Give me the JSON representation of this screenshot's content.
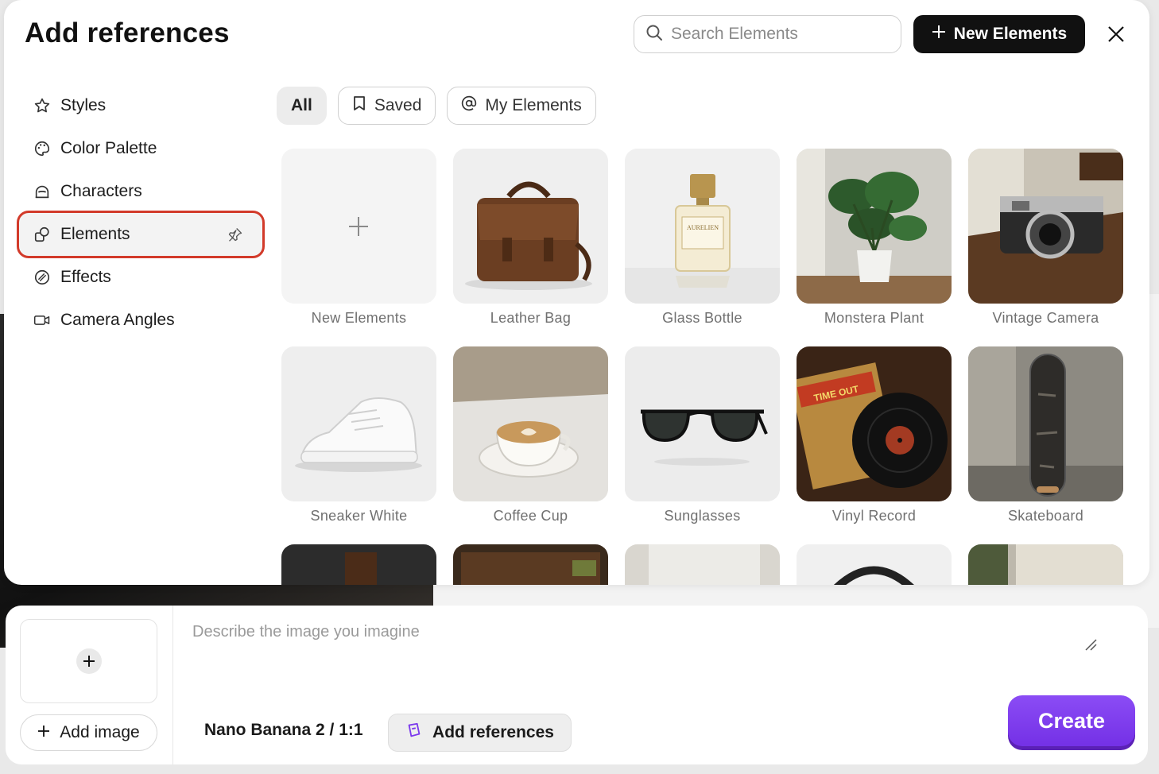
{
  "modal": {
    "title": "Add references",
    "search_placeholder": "Search Elements",
    "new_button_label": "New Elements"
  },
  "sidebar": {
    "items": [
      {
        "label": "Styles",
        "icon": "star-icon"
      },
      {
        "label": "Color Palette",
        "icon": "palette-icon"
      },
      {
        "label": "Characters",
        "icon": "character-icon"
      },
      {
        "label": "Elements",
        "icon": "shapes-icon",
        "active": true
      },
      {
        "label": "Effects",
        "icon": "effects-icon"
      },
      {
        "label": "Camera Angles",
        "icon": "video-camera-icon"
      }
    ]
  },
  "filters": [
    {
      "label": "All",
      "active": true
    },
    {
      "label": "Saved",
      "icon": "bookmark-icon"
    },
    {
      "label": "My Elements",
      "icon": "at-icon"
    }
  ],
  "elements": [
    {
      "label": "New Elements"
    },
    {
      "label": "Leather Bag"
    },
    {
      "label": "Glass Bottle",
      "bottle_text": "AURELIEN"
    },
    {
      "label": "Monstera Plant"
    },
    {
      "label": "Vintage Camera"
    },
    {
      "label": "Sneaker White"
    },
    {
      "label": "Coffee Cup"
    },
    {
      "label": "Sunglasses"
    },
    {
      "label": "Vinyl Record",
      "cover_text": "TIME OUT"
    },
    {
      "label": "Skateboard"
    }
  ],
  "composer": {
    "prompt_placeholder": "Describe the image you imagine",
    "add_image_label": "Add image",
    "model_label": "Nano Banana 2 / 1:1",
    "add_references_label": "Add references",
    "create_label": "Create"
  },
  "colors": {
    "accent": "#7c3aed",
    "highlight_outline": "#d23a2a",
    "primary_button": "#111111"
  }
}
